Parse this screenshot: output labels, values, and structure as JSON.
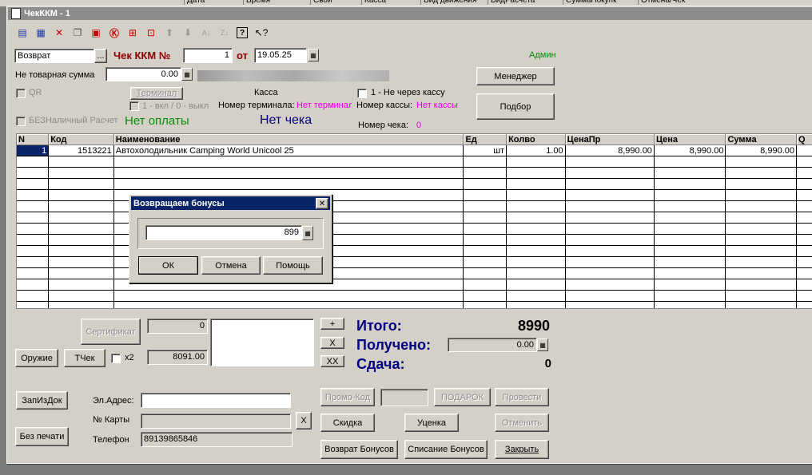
{
  "bg_columns": [
    "Дата",
    "Время",
    "Свой",
    "Касса",
    "Вид движения",
    "ВидРасчета",
    "СуммаПокупк",
    "Отмена/Чек"
  ],
  "window": {
    "title": "ЧекККМ - 1"
  },
  "toolbar": {
    "icons": [
      "new-row-icon",
      "edit-row-icon",
      "delete-row-icon",
      "copy-row-icon",
      "delete-mark-icon",
      "clear-icon",
      "property-icon",
      "row-select-icon",
      "move-up-icon",
      "move-down-icon",
      "sort-asc-icon",
      "sort-desc-icon",
      "help-icon",
      "context-help-icon"
    ]
  },
  "header": {
    "operation": "Возврат",
    "ellipsis": "...",
    "doc_label": "Чек ККМ №",
    "doc_number": "1",
    "date_label": "от",
    "date": "19.05.25",
    "user": "Админ",
    "non_goods_label": "Не товарная сумма",
    "non_goods_value": "0.00",
    "manager_button": "Менеджер",
    "select_button": "Подбор"
  },
  "terminal": {
    "qr_label": "QR",
    "terminal_button": "Терминал",
    "on_off_label": "1 - вкл / 0 - выкл",
    "cashless_label": "БЕЗНаличный Расчет",
    "no_payment": "Нет оплаты",
    "kassa_label": "Касса",
    "terminal_no_label": "Номер терминала:",
    "terminal_no_value": "Нет терминала",
    "no_receipt": "Нет чека",
    "not_through_kassa": "1 - Не через кассу",
    "kassa_no_label": "Номер кассы:",
    "kassa_no_value": "Нет кассы",
    "check_no_label": "Номер чека:",
    "check_no_value": "0"
  },
  "table": {
    "columns": [
      "N",
      "Код",
      "Наименование",
      "Ед",
      "Колво",
      "ЦенаПр",
      "Цена",
      "Сумма",
      "Q"
    ],
    "rows": [
      [
        "1",
        "1513221",
        "Автохолодильник Camping World Unicool 25",
        "шт",
        "1.00",
        "8,990.00",
        "8,990.00",
        "8,990.00",
        ""
      ]
    ]
  },
  "dialog": {
    "title": "Возвращаем бонусы",
    "close": "✕",
    "value": "899",
    "ok": "ОК",
    "cancel": "Отмена",
    "help": "Помощь"
  },
  "bottom": {
    "certificate_button": "Сертификат",
    "cert_value": "0",
    "weapon_button": "Оружие",
    "tcheck_button": "ТЧек",
    "x2_label": "x2",
    "sum_value": "8091.00",
    "plus": "+",
    "times": "X",
    "xx": "XX",
    "total_label": "Итого:",
    "total_value": "8990",
    "received_label": "Получено:",
    "received_value": "0.00",
    "change_label": "Сдача:",
    "change_value": "0",
    "fill_from_doc": "ЗапИзДок",
    "no_print": "Без печати",
    "email_label": "Эл.Адрес:",
    "email_value": "",
    "card_label": "№ Карты",
    "card_value": "",
    "card_clear": "X",
    "phone_label": "Телефон",
    "phone_value": "89139865846",
    "promo_button": "Промо-Код",
    "gift_button": "ПОДАРОК",
    "post_button": "Провести",
    "discount_button": "Скидка",
    "markdown_button": "Уценка",
    "cancel_button": "Отменить",
    "return_bonus_button": "Возврат Бонусов",
    "write_off_bonus_button": "Списание Бонусов",
    "close_button": "Закрыть"
  },
  "colors": {
    "titlebar": "#8c8c8c",
    "dialog_title": "#0a246a",
    "accent_red": "#8b0000",
    "magenta": "#e000e0",
    "green": "#0a8a0a",
    "navy": "#000080",
    "window_bg": "#d4d0c8"
  }
}
